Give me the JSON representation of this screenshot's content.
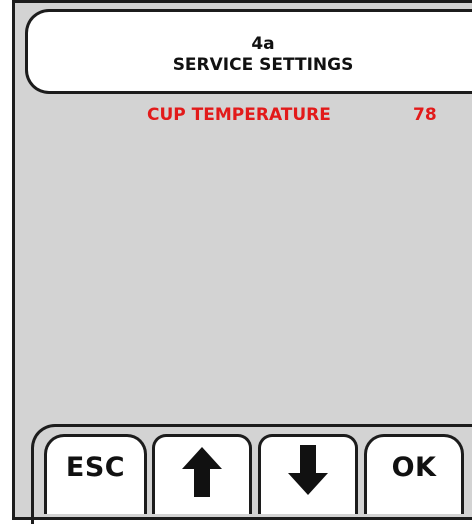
{
  "header": {
    "code": "4a",
    "title": "SERVICE SETTINGS"
  },
  "setting": {
    "label": "CUP TEMPERATURE",
    "value": "78",
    "color": "#e21a1a"
  },
  "buttons": {
    "esc_label": "ESC",
    "up_icon": "arrow-up-icon",
    "down_icon": "arrow-down-icon",
    "ok_label": "OK"
  },
  "colors": {
    "panel_bg": "#d3d3d3",
    "border": "#1c1c1c",
    "highlight": "#e21a1a"
  }
}
